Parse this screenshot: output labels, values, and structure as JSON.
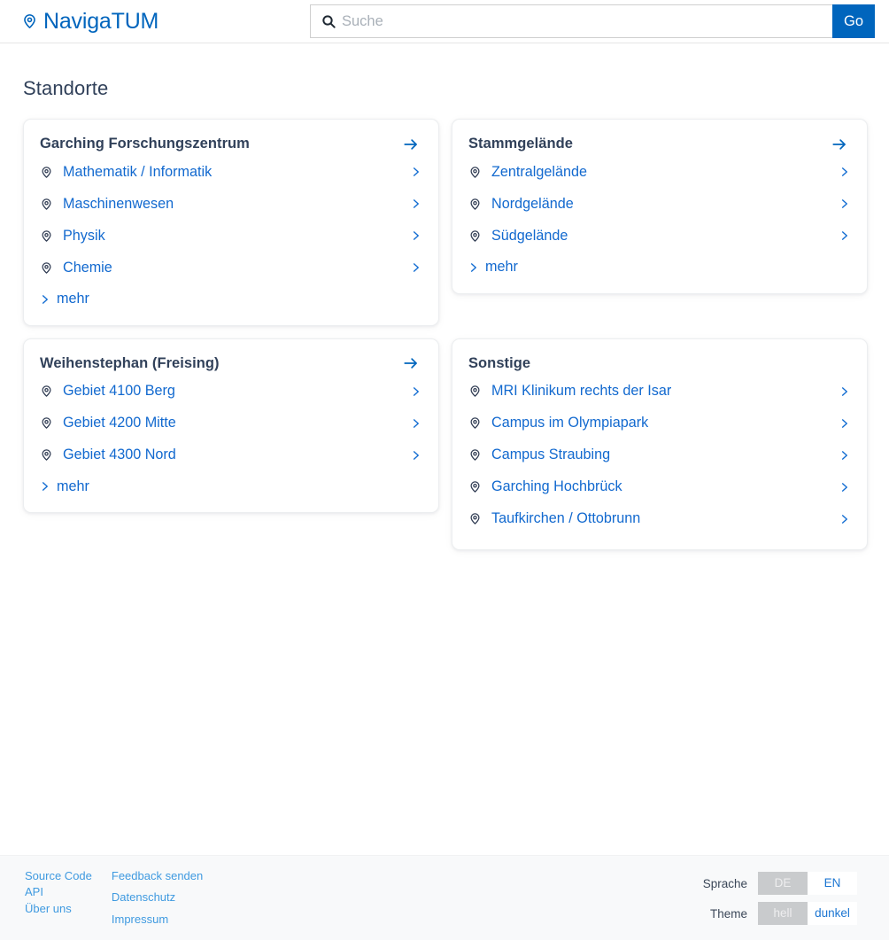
{
  "colors": {
    "brand_blue": "#0065bd",
    "link_blue": "#1269cf",
    "footer_link_blue": "#3f9ae0",
    "heading_navy": "#31415a",
    "footer_bg": "#f8f9fa",
    "toggle_active_bg": "#c9cbcd"
  },
  "header": {
    "brand": "NavigaTUM",
    "brand_icon": "map-pin-icon",
    "search": {
      "icon": "search-icon",
      "placeholder": "Suche",
      "value": ""
    },
    "go_label": "Go"
  },
  "main": {
    "page_title": "Standorte",
    "more_label": "mehr",
    "cards": [
      {
        "title": "Garching Forschungszentrum",
        "has_more": true,
        "items": [
          "Mathematik / Informatik",
          "Maschinenwesen",
          "Physik",
          "Chemie"
        ]
      },
      {
        "title": "Stammgelände",
        "has_more": true,
        "items": [
          "Zentralgelände",
          "Nordgelände",
          "Südgelände"
        ]
      },
      {
        "title": "Weihenstephan (Freising)",
        "has_more": true,
        "items": [
          "Gebiet 4100 Berg",
          "Gebiet 4200 Mitte",
          "Gebiet 4300 Nord"
        ]
      },
      {
        "title": "Sonstige",
        "has_more": false,
        "items": [
          "MRI Klinikum rechts der Isar",
          "Campus im Olympiapark",
          "Campus Straubing",
          "Garching Hochbrück",
          "Taufkirchen / Ottobrunn"
        ]
      }
    ]
  },
  "footer": {
    "links_col1": [
      "Source Code",
      "API",
      "Über uns"
    ],
    "links_col2": [
      "Feedback senden",
      "Datenschutz",
      "Impressum"
    ],
    "settings": [
      {
        "label": "Sprache",
        "options": [
          {
            "label": "DE",
            "active": true
          },
          {
            "label": "EN",
            "active": false
          }
        ]
      },
      {
        "label": "Theme",
        "options": [
          {
            "label": "hell",
            "active": true
          },
          {
            "label": "dunkel",
            "active": false
          }
        ]
      }
    ]
  }
}
